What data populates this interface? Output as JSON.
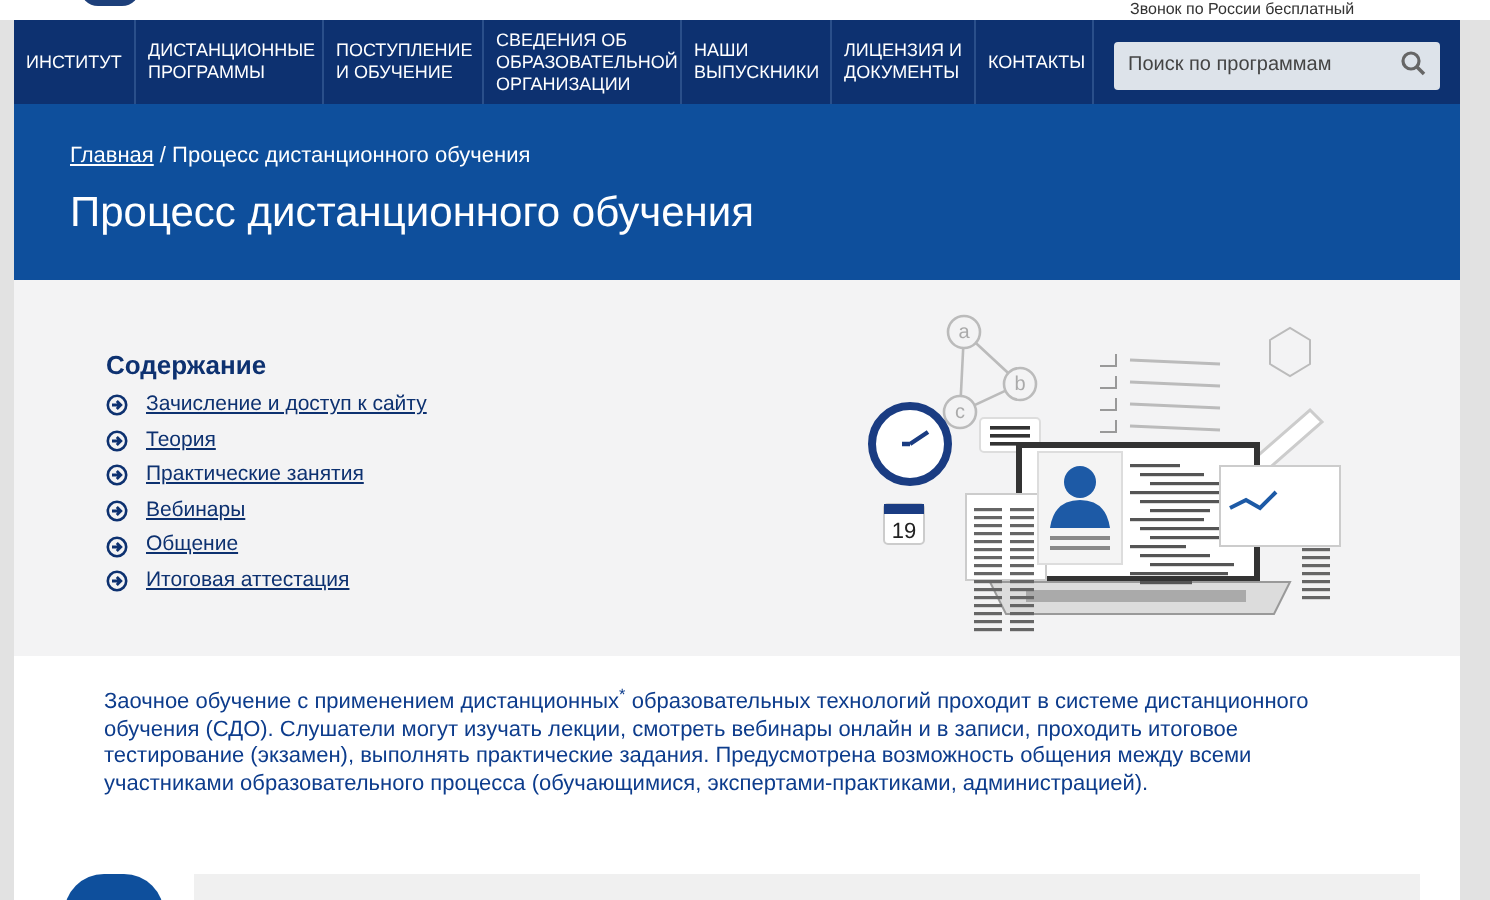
{
  "top_bar": {
    "phone_note": "Звонок по России бесплатный"
  },
  "nav": {
    "items": [
      {
        "label": "ИНСТИТУТ"
      },
      {
        "label": "ДИСТАНЦИОННЫЕ ПРОГРАММЫ"
      },
      {
        "label": "ПОСТУПЛЕНИЕ И ОБУЧЕНИЕ"
      },
      {
        "label": "СВЕДЕНИЯ ОБ ОБРАЗОВАТЕЛЬНОЙ ОРГАНИЗАЦИИ"
      },
      {
        "label": "НАШИ ВЫПУСКНИКИ"
      },
      {
        "label": "ЛИЦЕНЗИЯ И ДОКУМЕНТЫ"
      },
      {
        "label": "КОНТАКТЫ"
      }
    ],
    "search": {
      "placeholder": "Поиск по программам"
    }
  },
  "banner": {
    "breadcrumb": [
      {
        "label": "Главная",
        "kind": "link"
      },
      {
        "label": " / ",
        "kind": "separator"
      },
      {
        "label": "Процесс дистанционного обучения",
        "kind": "current"
      }
    ],
    "title": "Процесс дистанционного обучения"
  },
  "contents": {
    "heading": "Содержание",
    "items": [
      {
        "label": "Зачисление и доступ к сайту"
      },
      {
        "label": "Теория"
      },
      {
        "label": "Практические занятия"
      },
      {
        "label": "Вебинары"
      },
      {
        "label": "Общение"
      },
      {
        "label": "Итоговая аттестация"
      }
    ]
  },
  "illustration": {
    "graph_labels": [
      "a",
      "b",
      "c"
    ],
    "calendar_day": "19"
  },
  "intro": "Заочное обучение с применением дистанционных$^{*}$ образовательных технологий проходит в системе дистанционного обучения (СДО). Слушатели могут изучать лекции, смотреть вебинары онлайн и в записи, проходить итоговое тестирование (экзамен), выполнять практические задания. Предусмотрена возможность общения между всеми участниками образовательного процесса (обучающимися, экспертами-практиками, администрацией)."
}
